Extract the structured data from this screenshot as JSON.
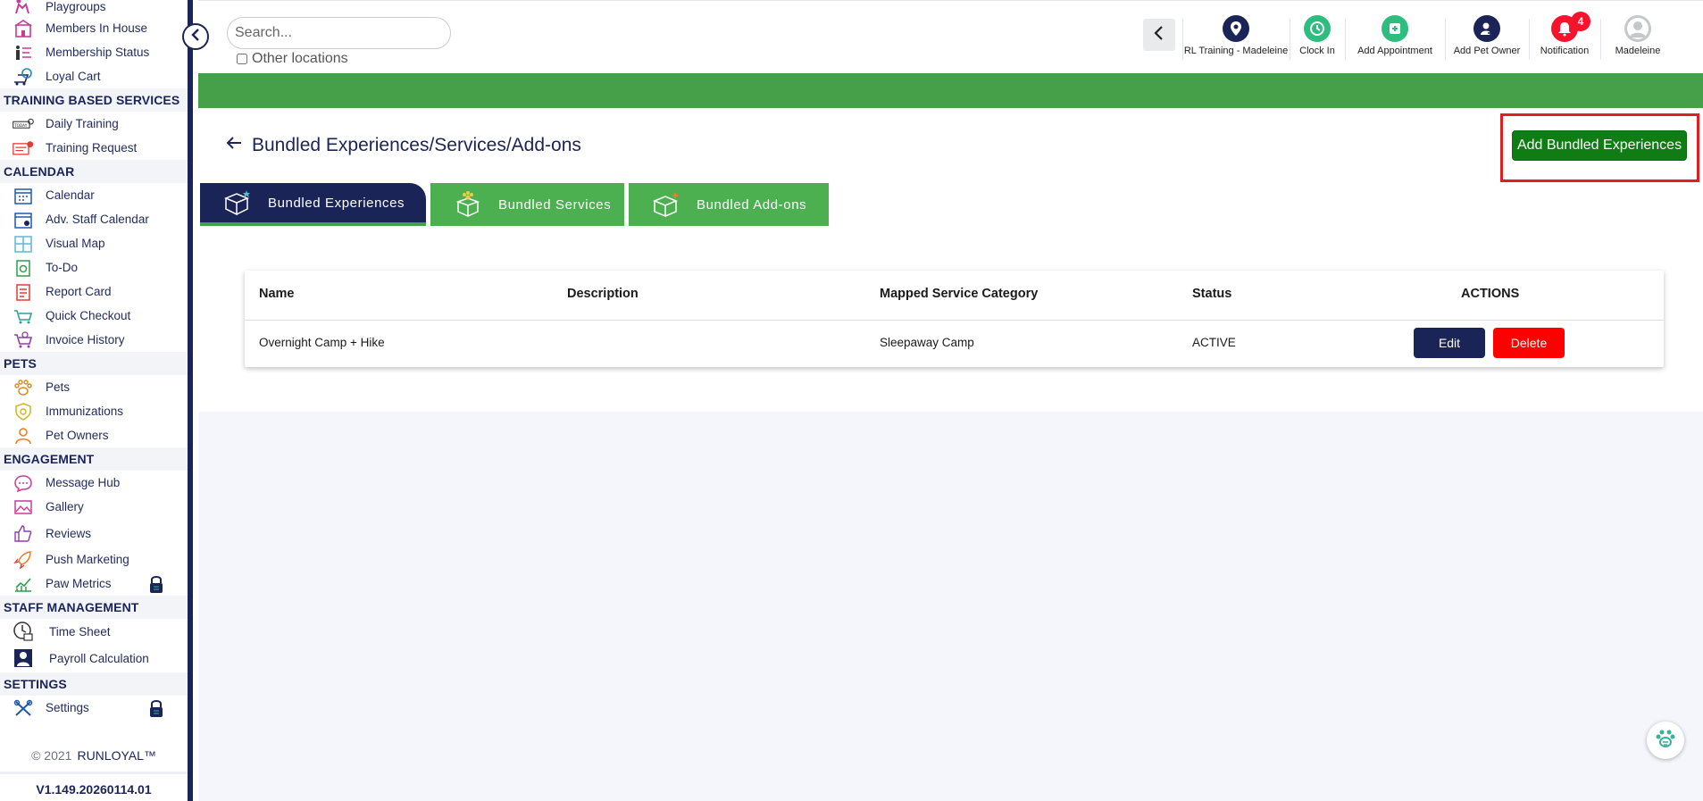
{
  "sidebar": {
    "items_top": [
      {
        "label": "Playgroups",
        "icon": "playgroups-icon"
      },
      {
        "label": "Members In House",
        "icon": "house-icon"
      },
      {
        "label": "Membership Status",
        "icon": "membership-icon"
      },
      {
        "label": "Loyal Cart",
        "icon": "cart-icon"
      }
    ],
    "sections": {
      "training": "TRAINING BASED SERVICES",
      "calendar": "CALENDAR",
      "pets": "PETS",
      "engagement": "ENGAGEMENT",
      "staff": "STAFF MANAGEMENT",
      "settings": "SETTINGS"
    },
    "training_items": [
      {
        "label": "Daily Training",
        "icon": "daily-training-icon"
      },
      {
        "label": "Training Request",
        "icon": "training-request-icon"
      }
    ],
    "calendar_items": [
      {
        "label": "Calendar",
        "icon": "calendar-icon"
      },
      {
        "label": "Adv. Staff Calendar",
        "icon": "staff-calendar-icon"
      },
      {
        "label": "Visual Map",
        "icon": "map-icon"
      },
      {
        "label": "To-Do",
        "icon": "todo-icon"
      },
      {
        "label": "Report Card",
        "icon": "report-card-icon"
      },
      {
        "label": "Quick Checkout",
        "icon": "checkout-icon"
      },
      {
        "label": "Invoice History",
        "icon": "invoice-icon"
      }
    ],
    "pets_items": [
      {
        "label": "Pets",
        "icon": "paw-icon"
      },
      {
        "label": "Immunizations",
        "icon": "immunization-icon"
      },
      {
        "label": "Pet Owners",
        "icon": "person-icon"
      }
    ],
    "engagement_items": [
      {
        "label": "Message Hub",
        "icon": "message-icon"
      },
      {
        "label": "Gallery",
        "icon": "gallery-icon"
      },
      {
        "label": "Reviews",
        "icon": "thumbs-up-icon"
      },
      {
        "label": "Push Marketing",
        "icon": "rocket-icon"
      },
      {
        "label": "Paw Metrics",
        "icon": "metrics-icon"
      }
    ],
    "staff_items": [
      {
        "label": "Time Sheet",
        "icon": "clock-icon"
      },
      {
        "label": "Payroll Calculation",
        "icon": "payroll-icon"
      }
    ],
    "settings_items": [
      {
        "label": "Settings",
        "icon": "tools-icon"
      }
    ],
    "copyright_year": "© 2021",
    "copyright_brand": "RUNLOYAL™",
    "version": "V1.149.20260114.01"
  },
  "header": {
    "search_placeholder": "Search...",
    "other_locations_label": "Other locations",
    "actions": [
      {
        "label": "RL Training - Madeleine",
        "color": "#1b2457"
      },
      {
        "label": "Clock In",
        "color": "#2dbd7e"
      },
      {
        "label": "Add Appointment",
        "color": "#2dbd7e"
      },
      {
        "label": "Add Pet Owner",
        "color": "#1b2457"
      },
      {
        "label": "Notification",
        "color": "#f5142b"
      },
      {
        "label": "Madeleine",
        "color": "#c4c7cc"
      }
    ],
    "notification_count": "4"
  },
  "main": {
    "page_title": "Bundled Experiences/Services/Add-ons",
    "add_button_label": "Add Bundled Experiences",
    "tabs": [
      {
        "label": "Bundled Experiences",
        "active": true
      },
      {
        "label": "Bundled Services",
        "active": false
      },
      {
        "label": "Bundled Add-ons",
        "active": false
      }
    ],
    "table": {
      "headers": [
        "Name",
        "Description",
        "Mapped Service Category",
        "Status",
        "ACTIONS"
      ],
      "rows": [
        {
          "name": "Overnight Camp + Hike",
          "description": "",
          "category": "Sleepaway Camp",
          "status": "ACTIVE"
        }
      ],
      "edit_label": "Edit",
      "delete_label": "Delete"
    }
  },
  "colors": {
    "navy": "#1b2457",
    "green": "#46a049",
    "button_green": "#0f7d14",
    "danger": "#ff0000",
    "highlight_frame": "#e02020"
  }
}
